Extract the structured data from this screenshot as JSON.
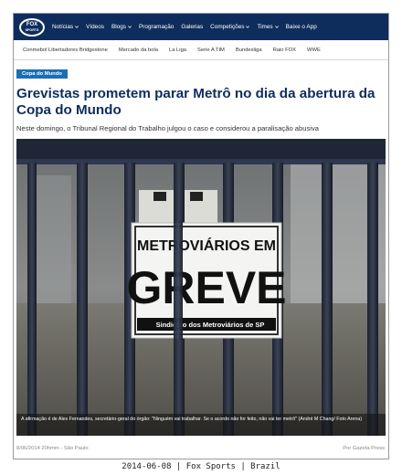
{
  "topbar": {
    "logo_line1": "FOX",
    "logo_line2": "SPORTS",
    "nav_items": [
      {
        "label": "Notícias",
        "dropdown": true
      },
      {
        "label": "Vídeos",
        "dropdown": false
      },
      {
        "label": "Blogs",
        "dropdown": true
      },
      {
        "label": "Programação",
        "dropdown": false
      },
      {
        "label": "Galerias",
        "dropdown": false
      },
      {
        "label": "Competições",
        "dropdown": true
      },
      {
        "label": "Times",
        "dropdown": true
      },
      {
        "label": "Baixe o App",
        "dropdown": false
      }
    ]
  },
  "subnav": {
    "items": [
      "Conmebol Libertadores Bridgestone",
      "Mercado da bola",
      "La Liga",
      "Serie A TIM",
      "Bundesliga",
      "Raio FOX",
      "WWE"
    ]
  },
  "article": {
    "category": "Copa do Mundo",
    "headline": "Grevistas prometem parar Metrô no dia da abertura da Copa do Mundo",
    "subtitle": "Neste domingo, o Tribunal Regional do Trabalho julgou o caso e considerou a paralisação abusiva",
    "photo": {
      "sign_line1": "METROVIÁRIOS EM",
      "sign_line2": "GREVE",
      "sign_footer": "Sindicato dos Metroviários de SP"
    },
    "caption": "A afirmação é de Alex Fernandes, secretário-geral do órgão: \"Ninguém vai trabalhar. Se o acordo não for feito, não vai ter metrô\" (André M Chang/ Foto Arena)",
    "date": "8/06/2014 20hmm - São Paulo",
    "source": "Por Gazeta Press"
  },
  "footer": "2014-06-08 | Fox Sports | Brazil",
  "colors": {
    "nav_bg": "#0e2d5c",
    "badge_bg": "#1a6fb4",
    "headline": "#0e2d5c"
  }
}
